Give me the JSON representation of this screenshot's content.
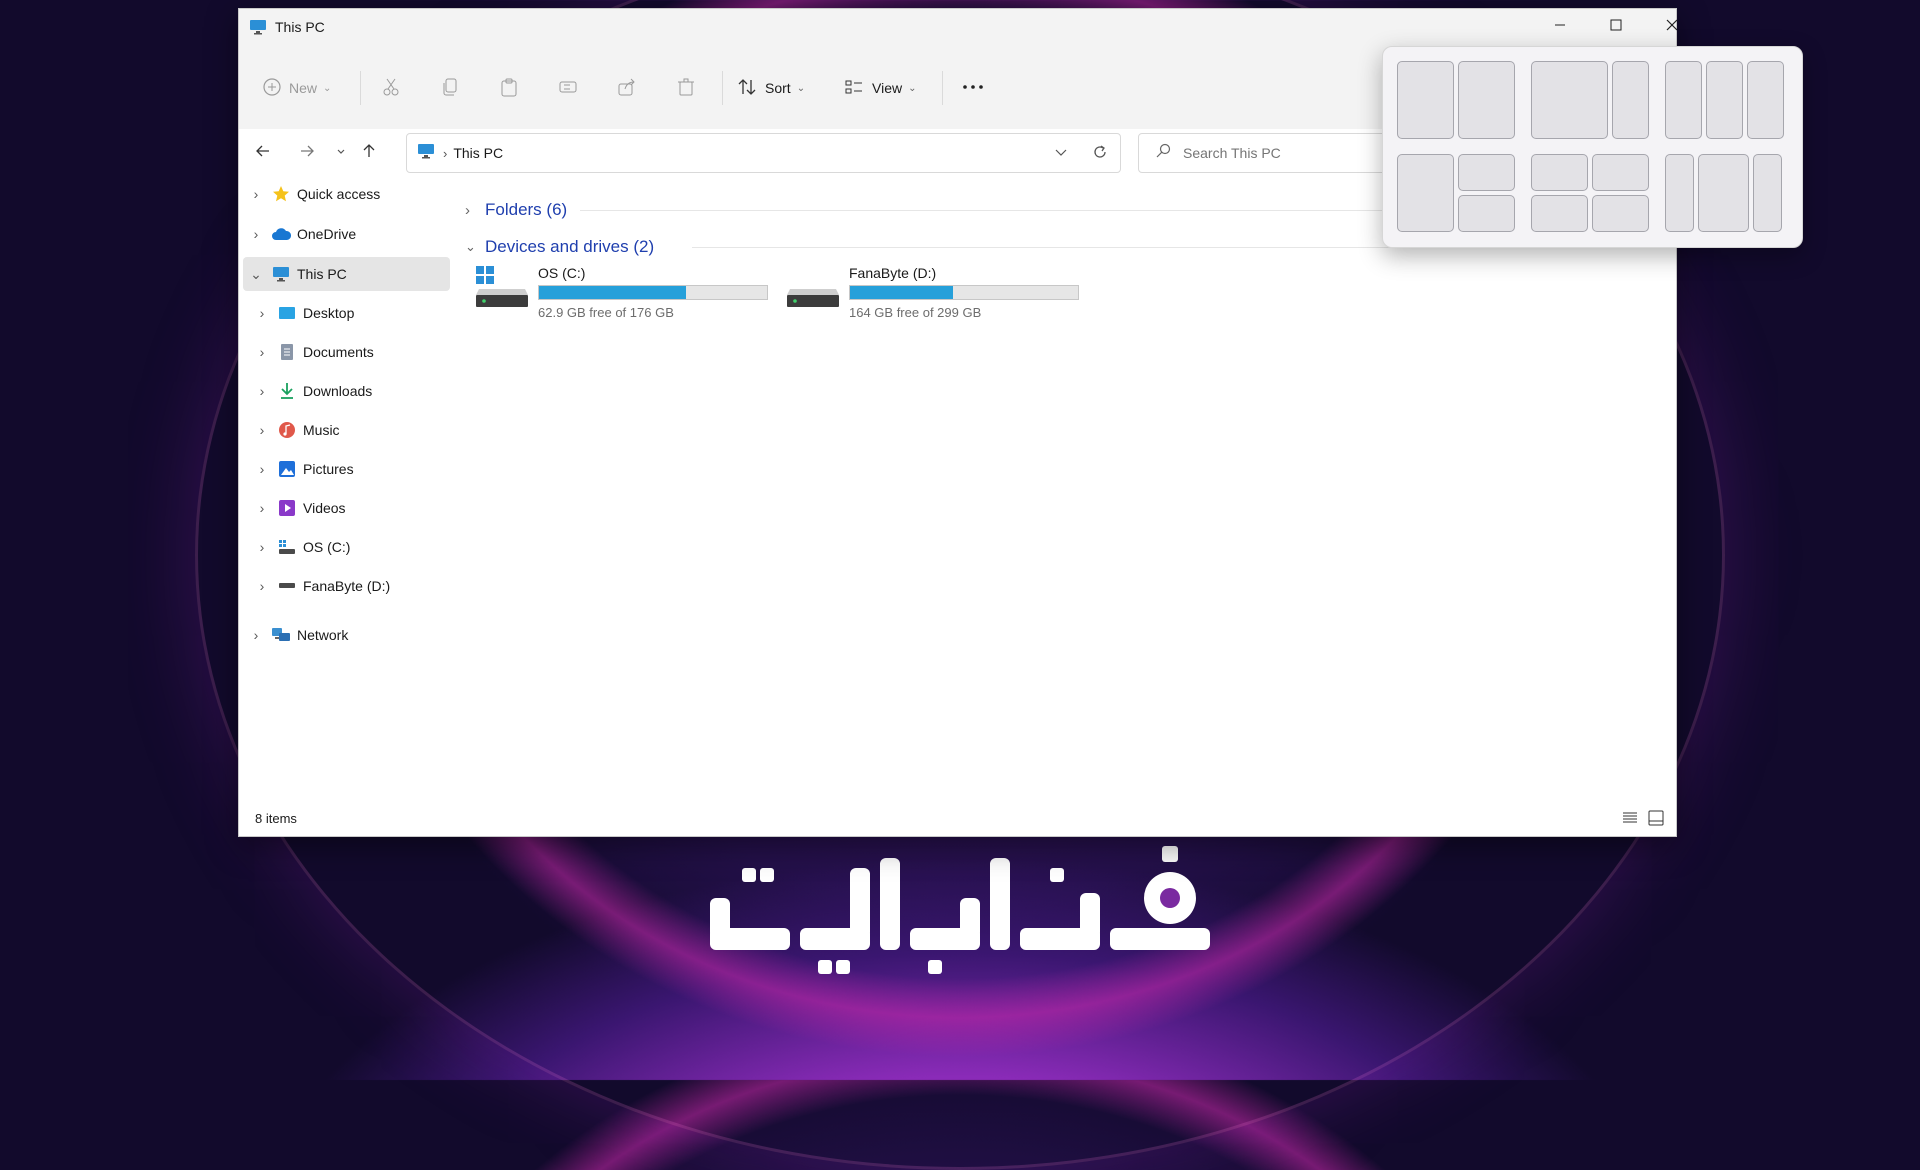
{
  "window": {
    "title": "This PC",
    "controls": [
      "minimize",
      "maximize",
      "close"
    ]
  },
  "toolbar": {
    "new_label": "New",
    "sort_label": "Sort",
    "view_label": "View",
    "icons": [
      "plus-circle-icon",
      "cut-icon",
      "copy-icon",
      "paste-icon",
      "rename-icon",
      "share-icon",
      "delete-icon",
      "sort-icon",
      "view-icon",
      "more-icon"
    ]
  },
  "address": {
    "path": "This PC",
    "separator": "›"
  },
  "search": {
    "placeholder": "Search This PC"
  },
  "sidebar": {
    "items": [
      {
        "label": "Quick access",
        "icon": "star-icon"
      },
      {
        "label": "OneDrive",
        "icon": "cloud-icon"
      },
      {
        "label": "This PC",
        "icon": "monitor-icon",
        "selected": true
      },
      {
        "label": "Desktop",
        "icon": "desktop-icon"
      },
      {
        "label": "Documents",
        "icon": "documents-icon"
      },
      {
        "label": "Downloads",
        "icon": "download-icon"
      },
      {
        "label": "Music",
        "icon": "music-icon"
      },
      {
        "label": "Pictures",
        "icon": "pictures-icon"
      },
      {
        "label": "Videos",
        "icon": "videos-icon"
      },
      {
        "label": "OS (C:)",
        "icon": "drive-c-icon"
      },
      {
        "label": "FanaByte (D:)",
        "icon": "drive-d-icon"
      },
      {
        "label": "Network",
        "icon": "network-icon"
      }
    ]
  },
  "content": {
    "folders_header": "Folders (6)",
    "drives_header": "Devices and drives (2)",
    "drives": [
      {
        "name": "OS (C:)",
        "free": "62.9 GB free of 176 GB",
        "used_fraction": 0.643
      },
      {
        "name": "FanaByte (D:)",
        "free": "164 GB free of 299 GB",
        "used_fraction": 0.452
      }
    ]
  },
  "status": {
    "items_text": "8 items"
  },
  "snap_layouts": {
    "layouts": [
      "half-half",
      "two-thirds-one-third",
      "three-columns",
      "half-plus-two-stacked",
      "quad-grid",
      "wide-center-three-columns"
    ]
  },
  "colors": {
    "accent": "#26a0da",
    "link_blue": "#1f3fae",
    "selected_bg": "#e5e5e5"
  }
}
